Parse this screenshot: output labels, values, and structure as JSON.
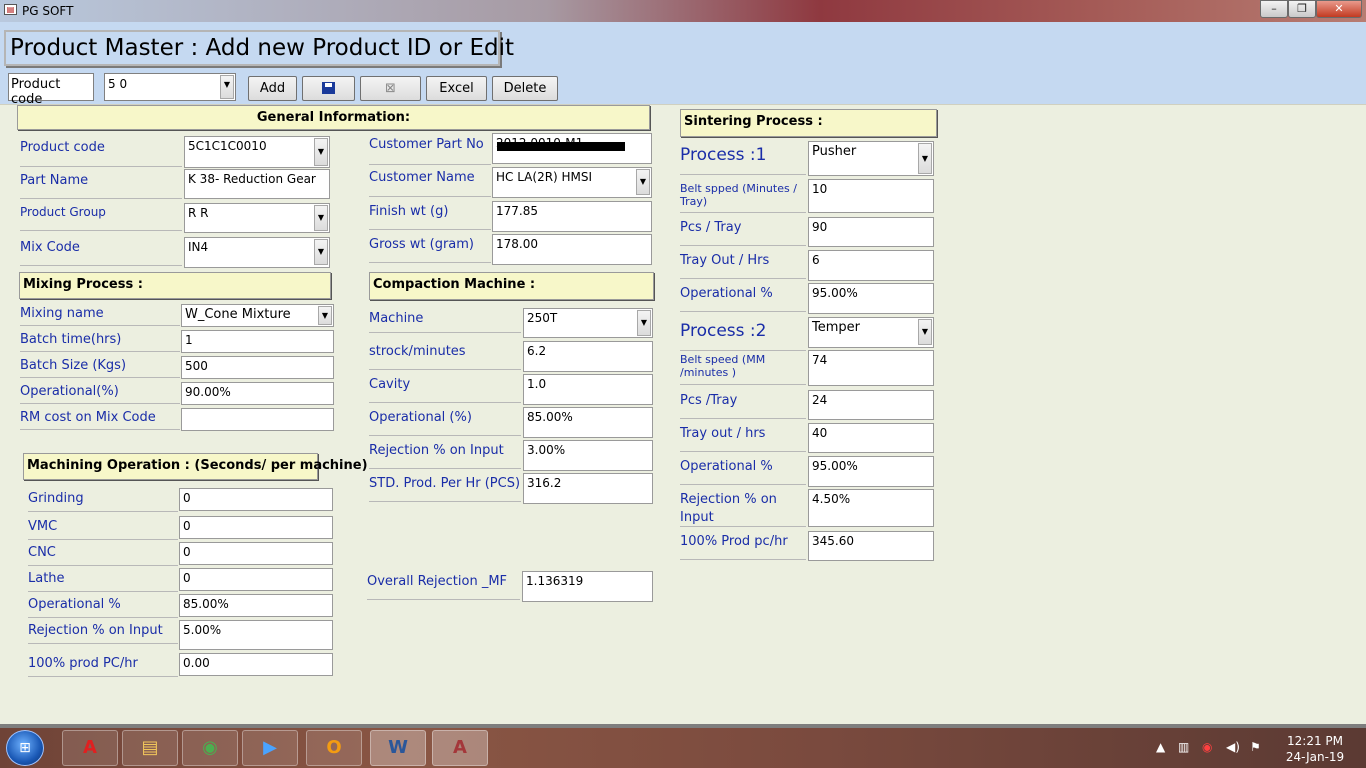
{
  "window": {
    "title": "PG SOFT",
    "minimize": "–",
    "restore": "❐",
    "close": "✕",
    "icon": "form-icon"
  },
  "header": {
    "form_title": "Product Master : Add new Product ID or Edit",
    "product_code_label": "Product code",
    "product_code_value": "5            0",
    "buttons": {
      "add": "Add",
      "save": "save-icon",
      "cancel": "⊠",
      "excel": "Excel",
      "delete": "Delete"
    }
  },
  "general": {
    "title": "General Information:",
    "product_code": {
      "label": "Product code",
      "value": "5C1C1C0010"
    },
    "part_name": {
      "label": "Part Name",
      "value": "K 38- Reduction Gear"
    },
    "product_group": {
      "label": "Product Group",
      "value": "R          R"
    },
    "mix_code": {
      "label": "Mix Code",
      "value": "IN4"
    },
    "customer_part_no": {
      "label": "Customer Part No",
      "value": "2012          0010-M1"
    },
    "customer_name": {
      "label": "Customer Name",
      "value": "HC    LA(2R)   HMSI"
    },
    "finish_wt": {
      "label": "Finish wt (g)",
      "value": "177.85"
    },
    "gross_wt": {
      "label": "Gross wt (gram)",
      "value": "178.00"
    }
  },
  "mixing": {
    "title": "Mixing Process  :",
    "mixing_name": {
      "label": "Mixing name",
      "value": "W_Cone Mixture"
    },
    "batch_time": {
      "label": "Batch time(hrs)",
      "value": "1"
    },
    "batch_size": {
      "label": "Batch Size (Kgs)",
      "value": "500"
    },
    "operational": {
      "label": "Operational(%)",
      "value": "90.00%"
    },
    "rm_cost": {
      "label": "RM cost on Mix Code",
      "value": ""
    }
  },
  "compaction": {
    "title": "Compaction Machine  :",
    "machine": {
      "label": "Machine",
      "value": "250T"
    },
    "strock": {
      "label": "strock/minutes",
      "value": "6.2"
    },
    "cavity": {
      "label": "Cavity",
      "value": "1.0"
    },
    "operational": {
      "label": "Operational (%)",
      "value": "85.00%"
    },
    "rejection": {
      "label": "Rejection % on Input",
      "value": "3.00%"
    },
    "std_prod": {
      "label": "STD. Prod. Per Hr (PCS)",
      "value": "316.2"
    },
    "overall_rejection": {
      "label": "Overall Rejection _MF",
      "value": "1.136319"
    }
  },
  "machining": {
    "title": "Machining Operation : (Seconds/ per machine)",
    "grinding": {
      "label": "Grinding",
      "value": "0"
    },
    "vmc": {
      "label": "VMC",
      "value": "0"
    },
    "cnc": {
      "label": "CNC",
      "value": "0"
    },
    "lathe": {
      "label": "Lathe",
      "value": "0"
    },
    "operational": {
      "label": "Operational %",
      "value": "85.00%"
    },
    "rejection": {
      "label": "Rejection % on Input",
      "value": "5.00%"
    },
    "prod": {
      "label": "100% prod PC/hr",
      "value": "0.00"
    }
  },
  "sintering": {
    "title": "Sintering Process :",
    "process1": {
      "label": "Process  :1",
      "value": "Pusher"
    },
    "belt_speed1": {
      "label": "Belt spped (Minutes / Tray)",
      "value": "10"
    },
    "pcs_tray1": {
      "label": "Pcs / Tray",
      "value": "90"
    },
    "tray_out1": {
      "label": "Tray Out / Hrs",
      "value": "6"
    },
    "operational1": {
      "label": "Operational %",
      "value": "95.00%"
    },
    "process2": {
      "label": "Process  :2",
      "value": "Temper"
    },
    "belt_speed2": {
      "label": "Belt speed (MM /minutes )",
      "value": "74"
    },
    "pcs_tray2": {
      "label": "Pcs /Tray",
      "value": "24"
    },
    "tray_out2": {
      "label": "Tray out / hrs",
      "value": "40"
    },
    "operational2": {
      "label": "Operational %",
      "value": "95.00%"
    },
    "rejection": {
      "label": "Rejection % on Input",
      "value": "4.50%"
    },
    "prod": {
      "label": "100% Prod pc/hr",
      "value": "345.60"
    }
  },
  "taskbar": {
    "start": "⊞",
    "apps": [
      {
        "name": "acrobat-icon",
        "glyph": "A"
      },
      {
        "name": "explorer-icon",
        "glyph": "▤"
      },
      {
        "name": "chrome-icon",
        "glyph": "◉"
      },
      {
        "name": "media-player-icon",
        "glyph": "▶"
      },
      {
        "name": "outlook-icon",
        "glyph": "O"
      },
      {
        "name": "word-icon",
        "glyph": "W"
      },
      {
        "name": "access-icon",
        "glyph": "A"
      }
    ],
    "time": "12:21 PM",
    "date": "24-Jan-19"
  }
}
